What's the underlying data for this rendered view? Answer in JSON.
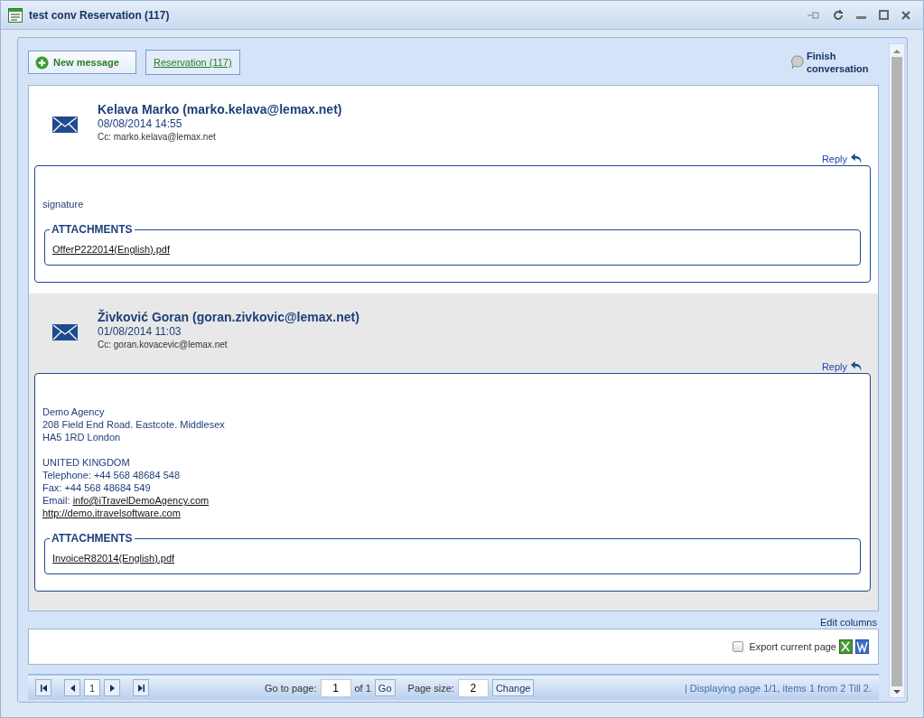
{
  "window": {
    "title": "test conv Reservation (117)"
  },
  "toolbar": {
    "new_message": "New message",
    "reservation_link": "Reservation (117)",
    "finish": "Finish conversation"
  },
  "messages": [
    {
      "selected": false,
      "sender": "Kelava Marko (marko.kelava@lemax.net)",
      "date": "08/08/2014 14:55",
      "cc": "Cc: marko.kelava@lemax.net",
      "reply": "Reply",
      "body": [
        [
          {
            "text": "signature"
          }
        ]
      ],
      "attachments_label": "ATTACHMENTS",
      "attachments": [
        "OfferP222014(English).pdf"
      ]
    },
    {
      "selected": true,
      "sender": "Živković Goran (goran.zivkovic@lemax.net)",
      "date": "01/08/2014 11:03",
      "cc": "Cc: goran.kovacevic@lemax.net",
      "reply": "Reply",
      "body": [
        [
          {
            "text": "Demo Agency"
          },
          {
            "text": "208 Field End Road. Eastcote. Middlesex"
          },
          {
            "text": "HA5 1RD London"
          }
        ],
        [
          {
            "text": "UNITED KINGDOM"
          },
          {
            "text": "Telephone: +44 568 48684 548"
          },
          {
            "text": "Fax: +44 568 48684 549"
          },
          {
            "text": "Email:",
            "link": "info@iTravelDemoAgency.com"
          },
          {
            "link": "http://demo.itravelsoftware.com"
          }
        ]
      ],
      "attachments_label": "ATTACHMENTS",
      "attachments": [
        "InvoiceR82014(English).pdf"
      ]
    }
  ],
  "grid": {
    "edit_columns": "Edit columns",
    "export": {
      "label": "Export current page",
      "checked": false
    }
  },
  "pager": {
    "page": "1",
    "goto_label": "Go to page:",
    "goto_value": "1",
    "of": "of 1",
    "go": "Go",
    "size_label": "Page size:",
    "size_value": "2",
    "change": "Change",
    "status": "| Displaying page  1/1,  items  1  from  2  Till  2."
  }
}
